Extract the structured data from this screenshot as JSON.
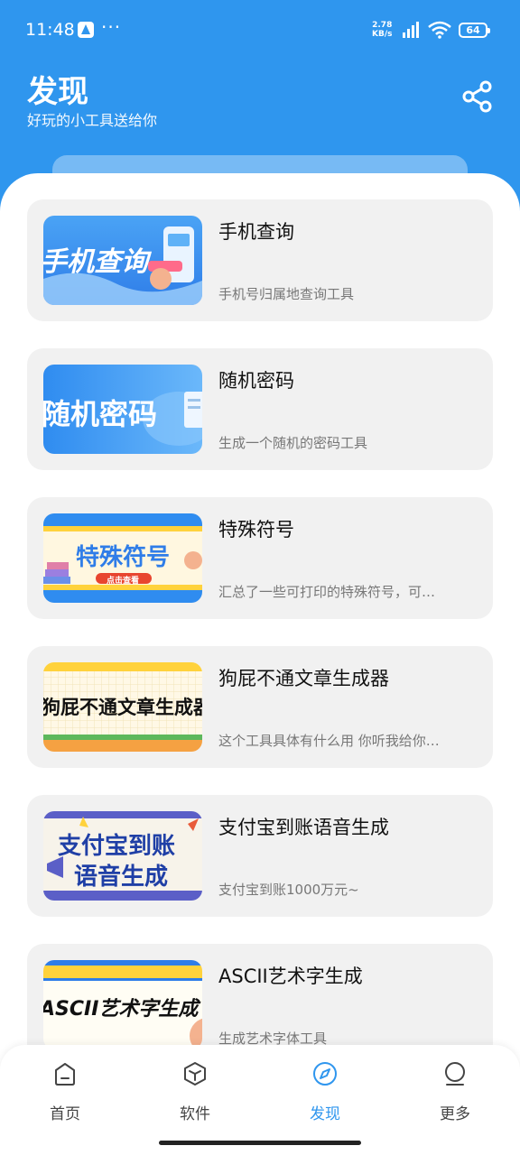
{
  "status_bar": {
    "time": "11:48",
    "dots": "···",
    "net_speed_value": "2.78",
    "net_speed_unit": "KB/s",
    "battery": "64"
  },
  "header": {
    "title": "发现",
    "subtitle": "好玩的小工具送给你",
    "share_icon": "share-icon"
  },
  "tools": [
    {
      "title": "手机查询",
      "desc": "手机号归属地查询工具",
      "thumb_text": "手机查询"
    },
    {
      "title": "随机密码",
      "desc": "生成一个随机的密码工具",
      "thumb_text": "随机密码"
    },
    {
      "title": "特殊符号",
      "desc": "汇总了一些可打印的特殊符号，可…",
      "thumb_text": "特殊符号",
      "thumb_button": "点击查看"
    },
    {
      "title": "狗屁不通文章生成器",
      "desc": "这个工具具体有什么用 你听我给你…",
      "thumb_text": "狗屁不通文章生成器"
    },
    {
      "title": "支付宝到账语音生成",
      "desc": "支付宝到账1000万元~",
      "thumb_text_line1": "支付宝到账",
      "thumb_text_line2": "语音生成"
    },
    {
      "title": "ASCII艺术字生成",
      "desc": "生成艺术字体工具",
      "thumb_text": "ASCII艺术字生成"
    }
  ],
  "nav": {
    "items": [
      {
        "label": "首页",
        "icon": "home-icon"
      },
      {
        "label": "软件",
        "icon": "cube-icon"
      },
      {
        "label": "发现",
        "icon": "compass-icon",
        "active": true
      },
      {
        "label": "更多",
        "icon": "person-icon"
      }
    ]
  },
  "colors": {
    "brand": "#2f96ee",
    "card_bg": "#f1f1f1",
    "text_secondary": "#777777"
  }
}
